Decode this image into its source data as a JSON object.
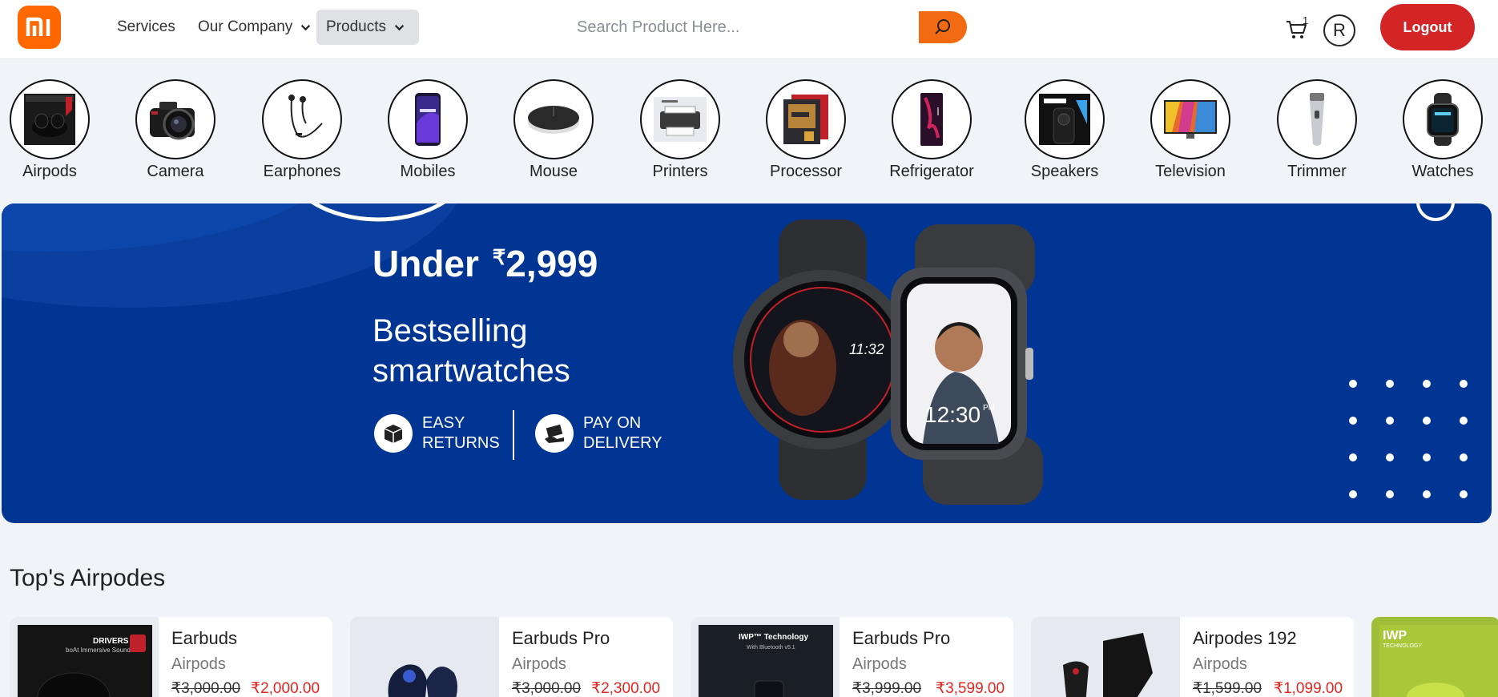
{
  "brand": {
    "logo_text": "mi",
    "color": "#ff6700"
  },
  "nav": {
    "services": "Services",
    "company": "Our Company",
    "products": "Products"
  },
  "search": {
    "placeholder": "Search Product Here...",
    "button_color": "#f26b12"
  },
  "header": {
    "cart_count": "1",
    "avatar_letter": "R",
    "logout_label": "Logout"
  },
  "categories": [
    {
      "label": "Airpods",
      "icon": "airpods-icon"
    },
    {
      "label": "Camera",
      "icon": "camera-icon"
    },
    {
      "label": "Earphones",
      "icon": "earphones-icon"
    },
    {
      "label": "Mobiles",
      "icon": "mobile-icon"
    },
    {
      "label": "Mouse",
      "icon": "mouse-icon"
    },
    {
      "label": "Printers",
      "icon": "printer-icon"
    },
    {
      "label": "Processor",
      "icon": "processor-icon"
    },
    {
      "label": "Refrigerator",
      "icon": "refrigerator-icon"
    },
    {
      "label": "Speakers",
      "icon": "speaker-icon"
    },
    {
      "label": "Television",
      "icon": "television-icon"
    },
    {
      "label": "Trimmer",
      "icon": "trimmer-icon"
    },
    {
      "label": "Watches",
      "icon": "watch-icon"
    }
  ],
  "banner": {
    "title_prefix": "Under",
    "currency": "₹",
    "price": "2,999",
    "subtitle": "Bestselling smartwatches",
    "feature1": "EASY RETURNS",
    "feature2": "PAY ON DELIVERY",
    "watch1_time": "11:32",
    "watch2_time": "12:30",
    "watch2_ampm": "PM",
    "background": "#003593"
  },
  "section": {
    "title": "Top's Airpodes"
  },
  "products": [
    {
      "name": "Earbuds",
      "category": "Airpods",
      "old_price": "₹3,000.00",
      "new_price": "₹2,000.00"
    },
    {
      "name": "Earbuds Pro",
      "category": "Airpods",
      "old_price": "₹3,000.00",
      "new_price": "₹2,300.00"
    },
    {
      "name": "Earbuds Pro",
      "category": "Airpods",
      "old_price": "₹3,999.00",
      "new_price": "₹3,599.00"
    },
    {
      "name": "Airpodes 192",
      "category": "Airpods",
      "old_price": "₹1,599.00",
      "new_price": "₹1,099.00"
    }
  ],
  "product_image_texts": {
    "p1": "DRIVERS",
    "p1_sub": "boAt Immersive Sound",
    "p3": "IWP™ Technology",
    "p3_sub": "With Bluetooth v5.1",
    "p5": "IWP",
    "p5_sub": "TECHNOLOGY"
  },
  "price_color": "#e0261f",
  "logout_color": "#d32426"
}
